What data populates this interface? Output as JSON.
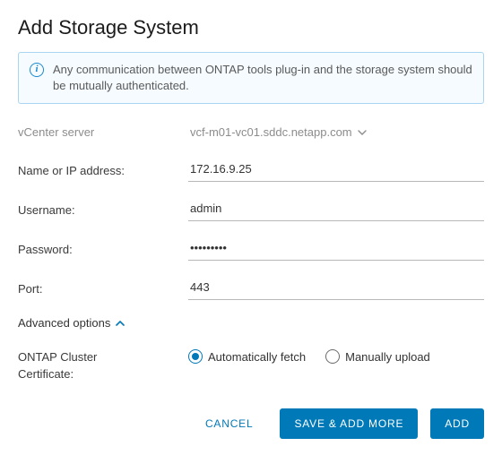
{
  "title": "Add Storage System",
  "info_message": "Any communication between ONTAP tools plug-in and the storage system should be mutually authenticated.",
  "labels": {
    "vcenter": "vCenter server",
    "name_ip": "Name or IP address:",
    "username": "Username:",
    "password": "Password:",
    "port": "Port:",
    "advanced": "Advanced options",
    "cert_line1": "ONTAP Cluster",
    "cert_line2": "Certificate:"
  },
  "values": {
    "vcenter_selected": "vcf-m01-vc01.sddc.netapp.com",
    "name_ip": "172.16.9.25",
    "username": "admin",
    "password": "•••••••••",
    "port": "443"
  },
  "radio": {
    "auto": "Automatically fetch",
    "manual": "Manually upload"
  },
  "buttons": {
    "cancel": "CANCEL",
    "save_add_more": "SAVE & ADD MORE",
    "add": "ADD"
  },
  "colors": {
    "primary": "#0079b8"
  }
}
